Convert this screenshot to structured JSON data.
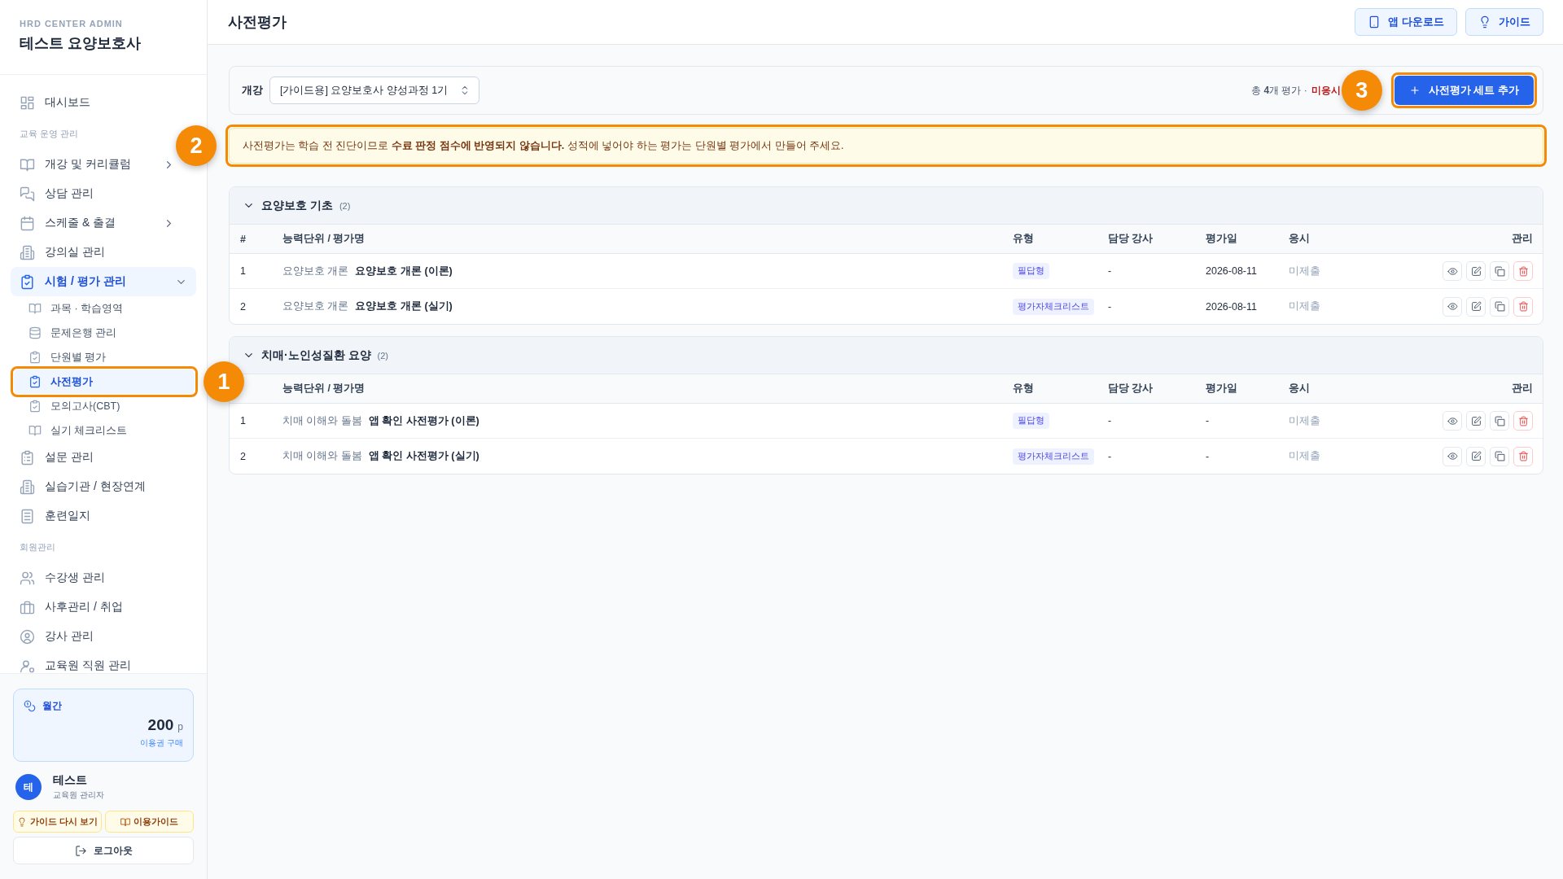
{
  "sidebar": {
    "brand": {
      "eyebrow": "HRD CENTER ADMIN",
      "title": "테스트 요양보호사"
    },
    "sections": [
      {
        "items": [
          {
            "label": "대시보드",
            "kind": "link",
            "selected": false
          }
        ]
      },
      {
        "heading": "교육 운영 관리",
        "items": [
          {
            "label": "개강 및 커리큘럼",
            "kind": "group",
            "selected": false,
            "expanded": false
          },
          {
            "label": "상담 관리",
            "kind": "link",
            "selected": false
          },
          {
            "label": "스케줄 & 출결",
            "kind": "group",
            "selected": false,
            "expanded": false
          },
          {
            "label": "강의실 관리",
            "kind": "link",
            "selected": false
          },
          {
            "label": "시험 / 평가 관리",
            "kind": "group",
            "selected": true,
            "expanded": true,
            "children": [
              {
                "label": "과목 · 학습영역",
                "selected": false
              },
              {
                "label": "문제은행 관리",
                "selected": false
              },
              {
                "label": "단원별 평가",
                "selected": false
              },
              {
                "label": "사전평가",
                "selected": true,
                "callout": "1"
              },
              {
                "label": "모의고사(CBT)",
                "selected": false
              },
              {
                "label": "실기 체크리스트",
                "selected": false
              }
            ]
          },
          {
            "label": "설문 관리",
            "kind": "link",
            "selected": false
          },
          {
            "label": "실습기관 / 현장연계",
            "kind": "link",
            "selected": false
          },
          {
            "label": "훈련일지",
            "kind": "link",
            "selected": false
          }
        ]
      },
      {
        "heading": "회원관리",
        "items": [
          {
            "label": "수강생 관리",
            "kind": "link",
            "selected": false
          },
          {
            "label": "사후관리 / 취업",
            "kind": "link",
            "selected": false
          },
          {
            "label": "강사 관리",
            "kind": "link",
            "selected": false
          },
          {
            "label": "교육원 직원 관리",
            "kind": "link",
            "selected": false
          }
        ]
      }
    ],
    "credit": {
      "label": "월간",
      "amount": "200",
      "unit": "p",
      "link": "이용권 구매"
    },
    "user": {
      "initial": "테",
      "name": "테스트",
      "role": "교육원 관리자"
    },
    "guide_buttons": [
      "가이드 다시 보기",
      "이용가이드"
    ],
    "logout": "로그아웃"
  },
  "header": {
    "title": "사전평가",
    "buttons": [
      "앱 다운로드",
      "가이드"
    ]
  },
  "filter": {
    "label": "개강",
    "value": "[가이드용] 요양보호사 양성과정 1기",
    "summary": "총 **4**개 평가 ·",
    "summary_alert": "미응시",
    "add_button": {
      "label": "사전평가 세트 추가",
      "callout": "3"
    }
  },
  "notice": {
    "text": "사전평가는 학습 전 진단이므로 **수료 판정 점수에 반영되지 않습니다.** 성적에 넣어야 하는 평가는 단원별 평가에서 만들어 주세요.",
    "callout": "2"
  },
  "groups": [
    {
      "title": "요양보호 기초",
      "count": "(2)",
      "expanded": true,
      "number_heading": "#",
      "columns": [
        "능력단위 / 평가명",
        "유형",
        "담당 강사",
        "평가일",
        "응시",
        "관리"
      ],
      "rows": [
        {
          "number": "1",
          "unit": "요양보호 개론",
          "name": "요양보호 개론 (이론)",
          "type": "필답형",
          "instructor": "-",
          "date": "2026-08-11",
          "status": "미제출"
        },
        {
          "number": "2",
          "unit": "요양보호 개론",
          "name": "요양보호 개론 (실기)",
          "type": "평가자체크리스트",
          "instructor": "-",
          "date": "2026-08-11",
          "status": "미제출"
        }
      ]
    },
    {
      "title": "치매·노인성질환 요양",
      "count": "(2)",
      "expanded": true,
      "columns": [
        "능력단위 / 평가명",
        "유형",
        "담당 강사",
        "평가일",
        "응시",
        "관리"
      ],
      "rows": [
        {
          "number": "1",
          "unit": "치매 이해와 돌봄",
          "name": "앱 확인 사전평가 (이론)",
          "type": "필답형",
          "instructor": "-",
          "date": "-",
          "status": "미제출"
        },
        {
          "number": "2",
          "unit": "치매 이해와 돌봄",
          "name": "앱 확인 사전평가 (실기)",
          "type": "평가자체크리스트",
          "instructor": "-",
          "date": "-",
          "status": "미제출"
        }
      ]
    }
  ]
}
